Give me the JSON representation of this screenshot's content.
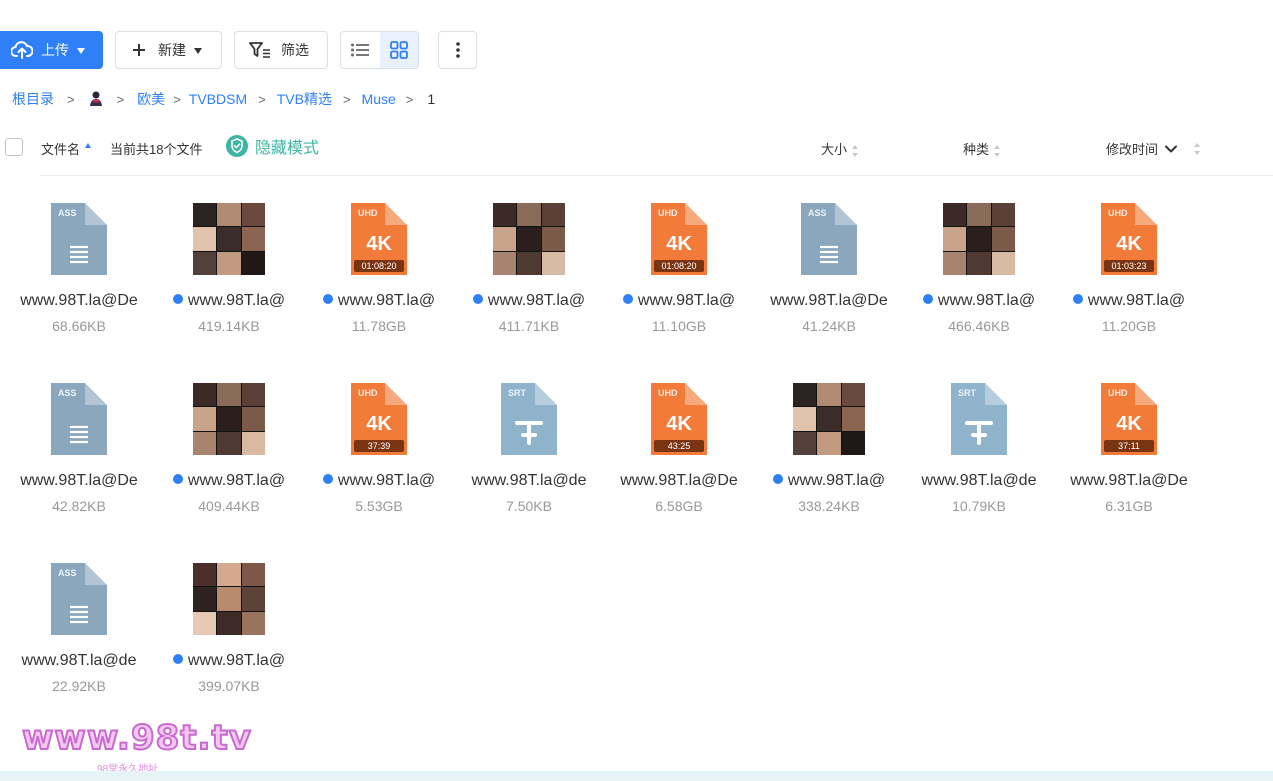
{
  "toolbar": {
    "upload_label": "上传",
    "new_label": "新建",
    "filter_label": "筛选"
  },
  "breadcrumb": {
    "root": "根目录",
    "items": [
      "欧美",
      "TVBDSM",
      "TVB精选",
      "Muse"
    ],
    "current": "1"
  },
  "header": {
    "name_label": "文件名",
    "count_text": "当前共18个文件",
    "hidden_mode": "隐藏模式",
    "size_label": "大小",
    "type_label": "种类",
    "mtime_label": "修改时间"
  },
  "files": [
    {
      "kind": "ass",
      "badge": "ASS",
      "name": "www.98T.la@De",
      "size": "68.66KB",
      "dot": false
    },
    {
      "kind": "video",
      "name": "www.98T.la@",
      "size": "419.14KB",
      "dot": true
    },
    {
      "kind": "4k",
      "badge": "UHD",
      "label": "4K",
      "duration": "01:08:20",
      "name": "www.98T.la@",
      "size": "11.78GB",
      "dot": true
    },
    {
      "kind": "video",
      "name": "www.98T.la@",
      "size": "411.71KB",
      "dot": true
    },
    {
      "kind": "4k",
      "badge": "UHD",
      "label": "4K",
      "duration": "01:08:20",
      "name": "www.98T.la@",
      "size": "11.10GB",
      "dot": true
    },
    {
      "kind": "ass",
      "badge": "ASS",
      "name": "www.98T.la@De",
      "size": "41.24KB",
      "dot": false
    },
    {
      "kind": "video",
      "name": "www.98T.la@",
      "size": "466.46KB",
      "dot": true
    },
    {
      "kind": "4k",
      "badge": "UHD",
      "label": "4K",
      "duration": "01:03:23",
      "name": "www.98T.la@",
      "size": "11.20GB",
      "dot": true
    },
    {
      "kind": "ass",
      "badge": "ASS",
      "name": "www.98T.la@De",
      "size": "42.82KB",
      "dot": false
    },
    {
      "kind": "video",
      "name": "www.98T.la@",
      "size": "409.44KB",
      "dot": true
    },
    {
      "kind": "4k",
      "badge": "UHD",
      "label": "4K",
      "duration": "37:39",
      "name": "www.98T.la@",
      "size": "5.53GB",
      "dot": true
    },
    {
      "kind": "srt",
      "badge": "SRT",
      "name": "www.98T.la@de",
      "size": "7.50KB",
      "dot": false
    },
    {
      "kind": "4k",
      "badge": "UHD",
      "label": "4K",
      "duration": "43:25",
      "name": "www.98T.la@De",
      "size": "6.58GB",
      "dot": false
    },
    {
      "kind": "video",
      "name": "www.98T.la@",
      "size": "338.24KB",
      "dot": true
    },
    {
      "kind": "srt",
      "badge": "SRT",
      "name": "www.98T.la@de",
      "size": "10.79KB",
      "dot": false
    },
    {
      "kind": "4k",
      "badge": "UHD",
      "label": "4K",
      "duration": "37:11",
      "name": "www.98T.la@De",
      "size": "6.31GB",
      "dot": false
    },
    {
      "kind": "ass",
      "badge": "ASS",
      "name": "www.98T.la@de",
      "size": "22.92KB",
      "dot": false
    },
    {
      "kind": "video",
      "name": "www.98T.la@",
      "size": "399.07KB",
      "dot": true
    }
  ],
  "watermark": {
    "text": "www.98t.tv",
    "sub": "98堂永久地址"
  },
  "colors": {
    "accent": "#2f7ff7",
    "ass_icon": "#8aa7bd",
    "srt_icon": "#8fb3cb",
    "uhd_icon": "#f37b3a",
    "hidden_mode": "#3cb5a3"
  }
}
